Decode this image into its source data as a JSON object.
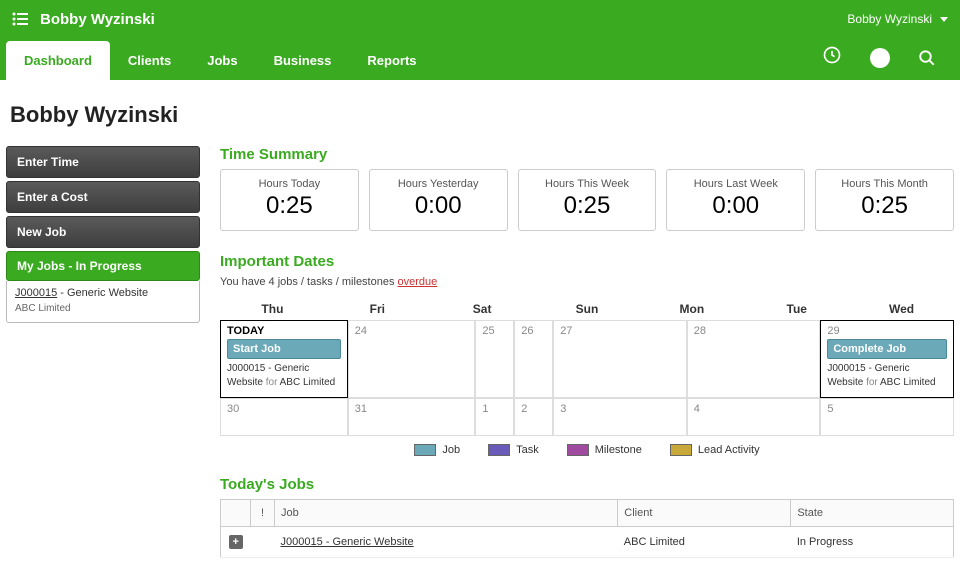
{
  "header": {
    "company": "Bobby Wyzinski",
    "user": "Bobby Wyzinski"
  },
  "nav": {
    "tabs": [
      {
        "label": "Dashboard",
        "active": true
      },
      {
        "label": "Clients",
        "active": false
      },
      {
        "label": "Jobs",
        "active": false
      },
      {
        "label": "Business",
        "active": false
      },
      {
        "label": "Reports",
        "active": false
      }
    ]
  },
  "page_title": "Bobby Wyzinski",
  "sidebar": {
    "buttons": [
      "Enter Time",
      "Enter a Cost",
      "New Job"
    ],
    "active": "My Jobs - In Progress",
    "sub": {
      "link": "J000015",
      "title": " - Generic Website",
      "client": "ABC Limited"
    }
  },
  "time_summary": {
    "heading": "Time Summary",
    "cards": [
      {
        "label": "Hours Today",
        "value": "0:25"
      },
      {
        "label": "Hours Yesterday",
        "value": "0:00"
      },
      {
        "label": "Hours This Week",
        "value": "0:25"
      },
      {
        "label": "Hours Last Week",
        "value": "0:00"
      },
      {
        "label": "Hours This Month",
        "value": "0:25"
      }
    ]
  },
  "important_dates": {
    "heading": "Important Dates",
    "note_pre": "You have 4 jobs / tasks / milestones ",
    "note_link": "overdue",
    "day_headers": [
      "Thu",
      "Fri",
      "Sat",
      "Sun",
      "Mon",
      "Tue",
      "Wed"
    ],
    "row1": {
      "thu": {
        "today": "TODAY",
        "tag": "Start Job",
        "desc": "J000015 - Generic Website",
        "for": "for",
        "client": "ABC Limited"
      },
      "fri": "24",
      "sat": "25",
      "sun": "26",
      "mon": "27",
      "tue": "28",
      "wed": {
        "num": "29",
        "tag": "Complete Job",
        "desc": "J000015 - Generic Website",
        "for": "for",
        "client": "ABC Limited"
      }
    },
    "row2": {
      "thu": "30",
      "fri": "31",
      "sat": "1",
      "sun": "2",
      "mon": "3",
      "tue": "4",
      "wed": "5"
    },
    "legend": [
      {
        "label": "Job",
        "class": "sw-job"
      },
      {
        "label": "Task",
        "class": "sw-task"
      },
      {
        "label": "Milestone",
        "class": "sw-mile"
      },
      {
        "label": "Lead Activity",
        "class": "sw-lead"
      }
    ]
  },
  "todays_jobs": {
    "heading": "Today's Jobs",
    "cols": {
      "excl": "!",
      "job": "Job",
      "client": "Client",
      "state": "State"
    },
    "rows": [
      {
        "job": "J000015 - Generic Website",
        "client": "ABC Limited",
        "state": "In Progress"
      }
    ]
  }
}
